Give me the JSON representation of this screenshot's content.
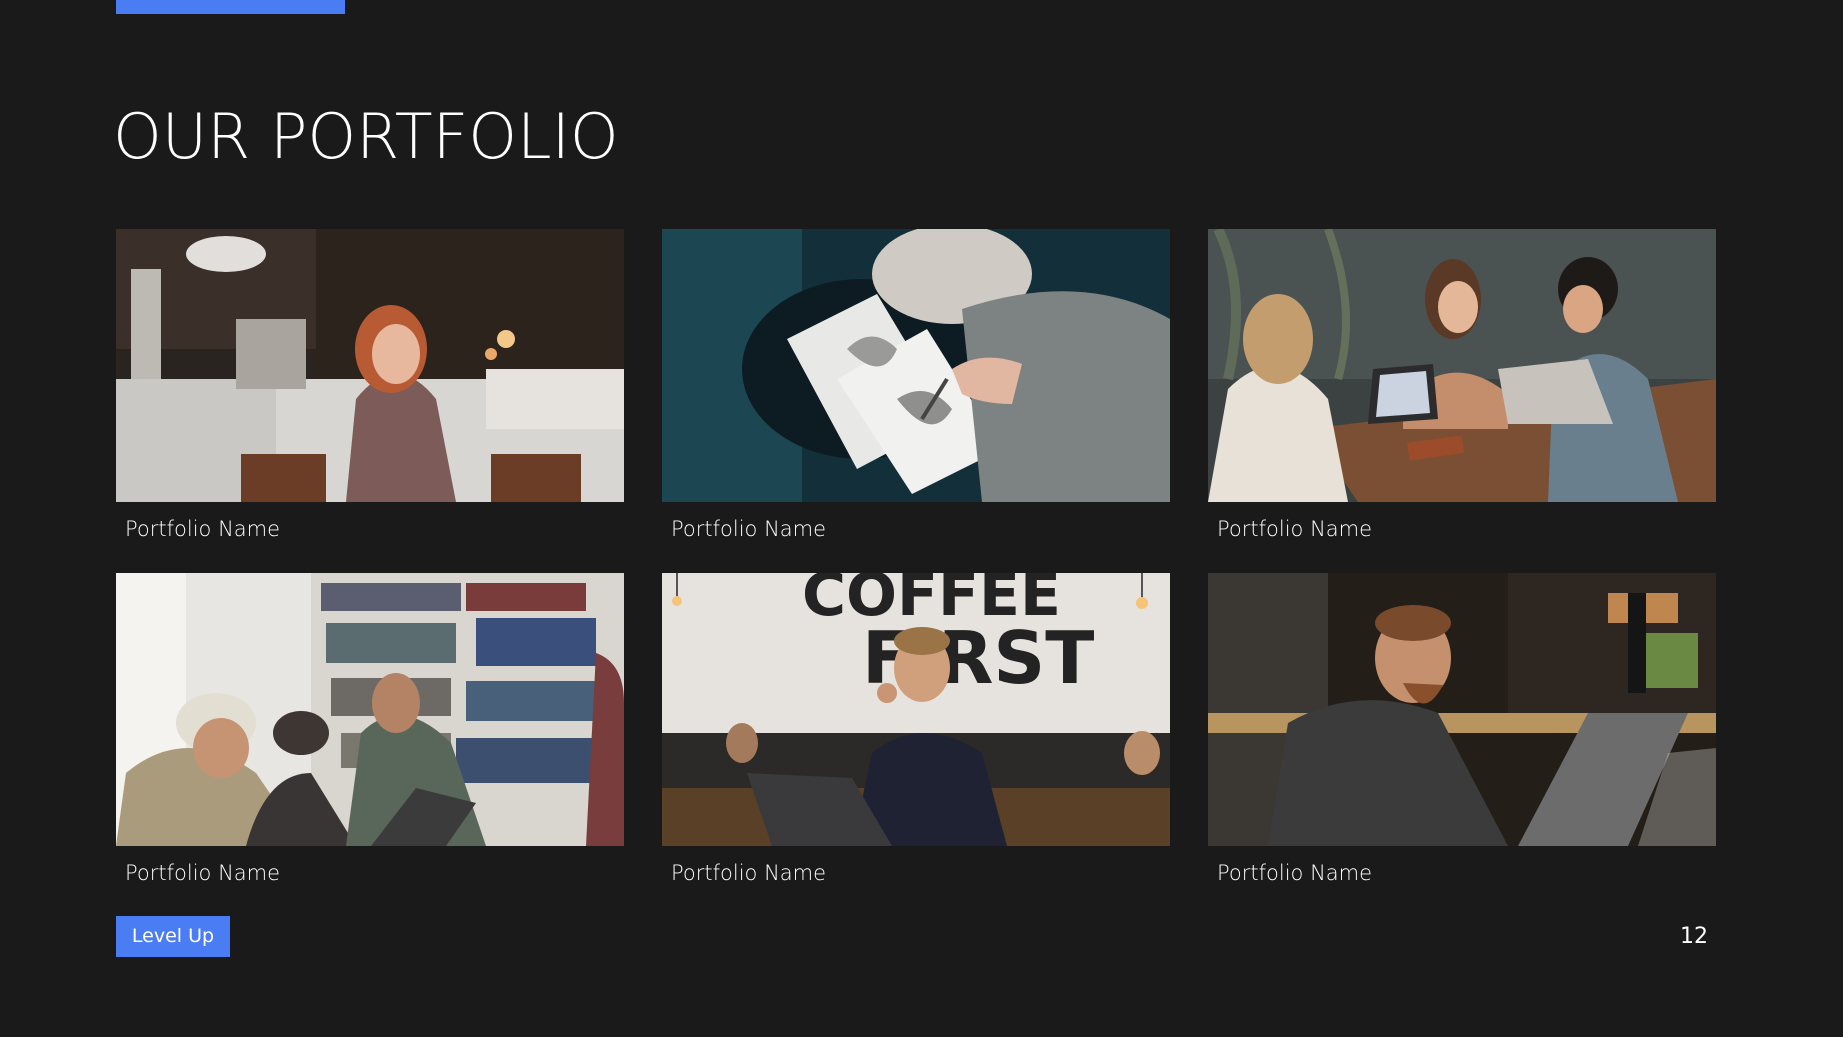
{
  "slide": {
    "title": "OUR PORTFOLIO",
    "tag_label": "Level Up",
    "page_number": "12",
    "accent_color": "#4a7cf4",
    "background_color": "#1a1a1a"
  },
  "portfolio": {
    "items": [
      {
        "name": "Portfolio Name",
        "image": "woman-in-cafe-photo"
      },
      {
        "name": "Portfolio Name",
        "image": "person-sketching-photo"
      },
      {
        "name": "Portfolio Name",
        "image": "group-with-laptops-photo"
      },
      {
        "name": "Portfolio Name",
        "image": "men-in-library-photo"
      },
      {
        "name": "Portfolio Name",
        "image": "man-on-phone-coffee-shop-photo"
      },
      {
        "name": "Portfolio Name",
        "image": "man-with-laptop-cafe-photo"
      }
    ]
  }
}
